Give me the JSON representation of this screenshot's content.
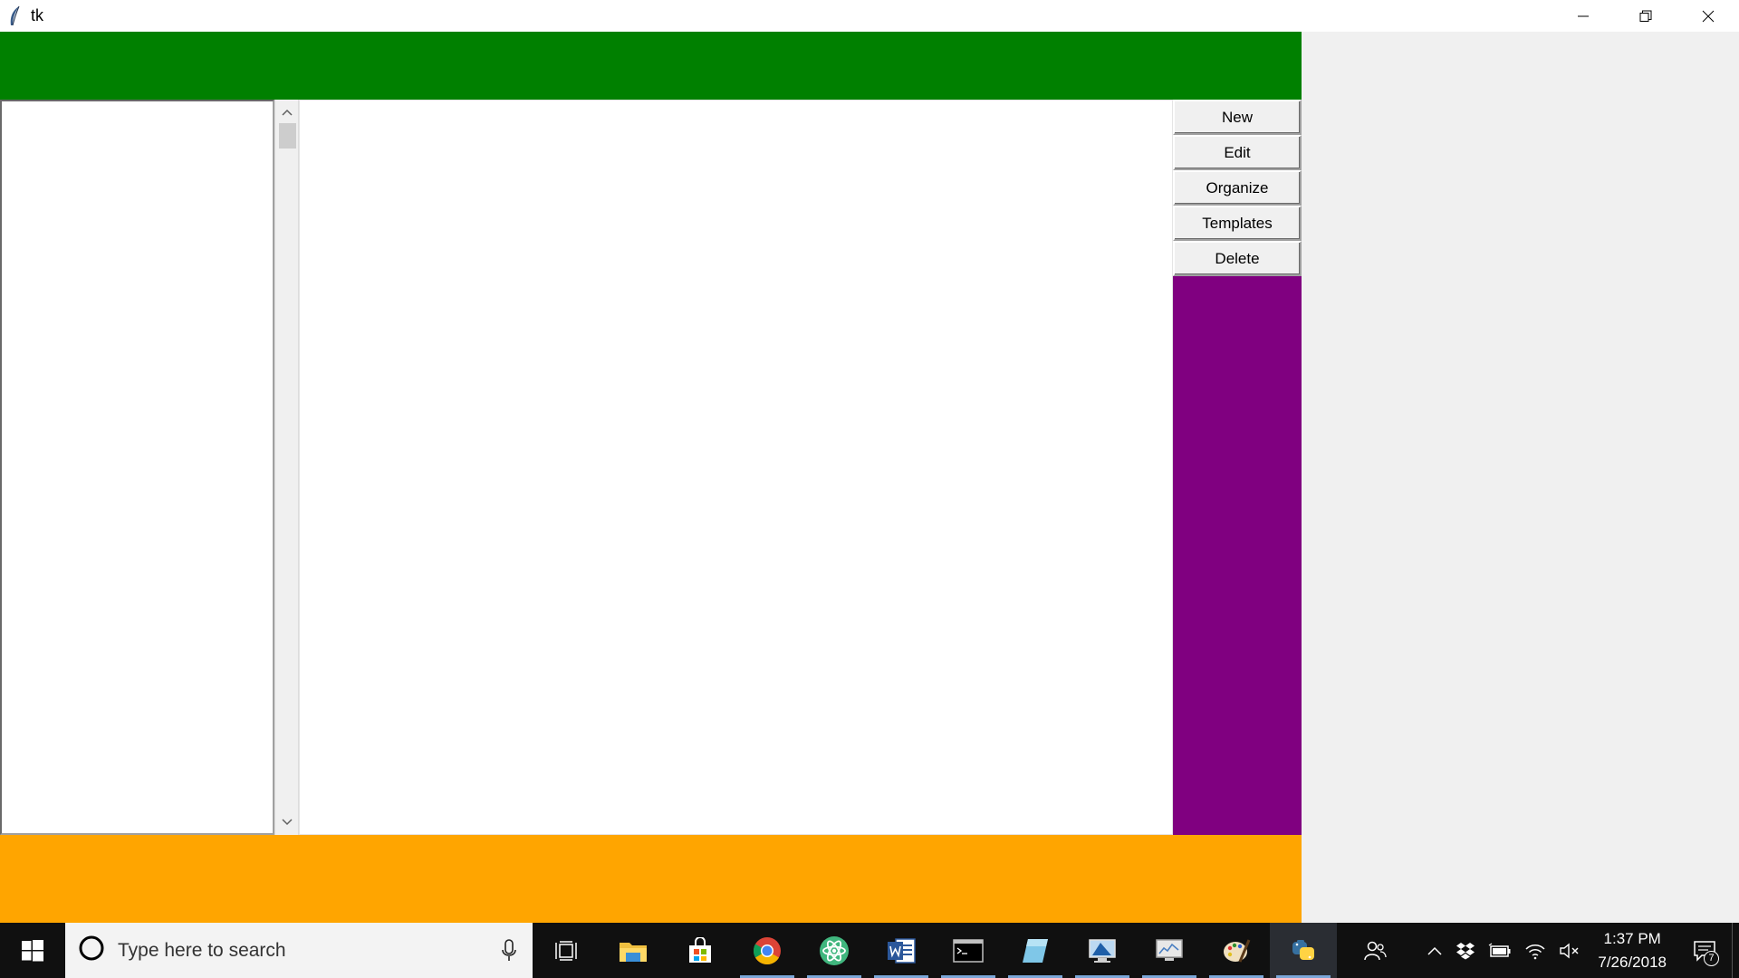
{
  "window": {
    "title": "tk"
  },
  "colors": {
    "top_frame": "#008000",
    "side_frame": "#800080",
    "bottom_frame": "#ffa500"
  },
  "buttons": [
    {
      "label": "New"
    },
    {
      "label": "Edit"
    },
    {
      "label": "Organize"
    },
    {
      "label": "Templates"
    },
    {
      "label": "Delete"
    }
  ],
  "taskbar": {
    "search_placeholder": "Type here to search",
    "apps": [
      "task-view-icon",
      "file-explorer-icon",
      "store-icon",
      "chrome-icon",
      "atom-icon",
      "word-icon",
      "terminal-icon",
      "notes-icon",
      "remote-desktop-icon",
      "monitor-icon",
      "paint-icon",
      "python-icon"
    ],
    "time": "1:37 PM",
    "date": "7/26/2018",
    "notification_count": "7"
  }
}
